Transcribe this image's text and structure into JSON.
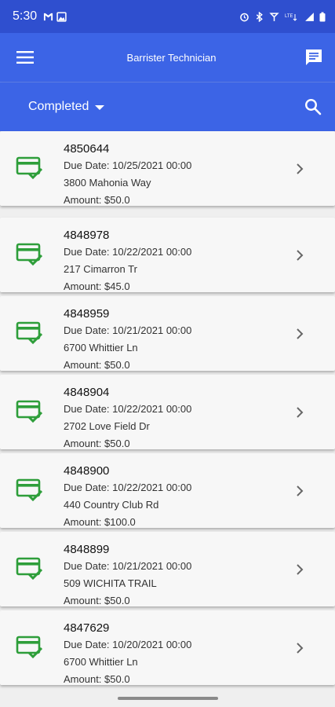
{
  "status_bar": {
    "time": "5:30",
    "left_icons": [
      "gmail-icon",
      "image-icon"
    ],
    "right_icons": [
      "alarm-icon",
      "bluetooth-icon",
      "hotspot-icon",
      "lte-icon",
      "signal-icon",
      "battery-icon"
    ],
    "network_label": "LTE"
  },
  "app_bar": {
    "title": "Barrister Technician",
    "menu_icon": "hamburger-menu-icon",
    "chat_icon": "chat-icon"
  },
  "filter_bar": {
    "selected": "Completed",
    "search_icon": "search-icon"
  },
  "work_orders": [
    {
      "number": "4850644",
      "due": "Due Date: 10/25/2021 00:00",
      "address": "3800 Mahonia Way",
      "amount": "Amount: $50.0"
    },
    {
      "number": "4848978",
      "due": "Due Date: 10/22/2021 00:00",
      "address": "217 Cimarron Tr",
      "amount": "Amount: $45.0"
    },
    {
      "number": "4848959",
      "due": "Due Date: 10/21/2021 00:00",
      "address": "6700 Whittier Ln",
      "amount": "Amount: $50.0"
    },
    {
      "number": "4848904",
      "due": "Due Date: 10/22/2021 00:00",
      "address": "2702 Love Field Dr",
      "amount": "Amount: $50.0"
    },
    {
      "number": "4848900",
      "due": "Due Date: 10/22/2021 00:00",
      "address": "440 Country Club Rd",
      "amount": "Amount: $100.0"
    },
    {
      "number": "4848899",
      "due": "Due Date: 10/21/2021 00:00",
      "address": "509 WICHITA TRAIL",
      "amount": "Amount: $50.0"
    },
    {
      "number": "4847629",
      "due": "Due Date: 10/20/2021 00:00",
      "address": "6700 Whittier Ln",
      "amount": "Amount: $50.0"
    }
  ],
  "colors": {
    "status_bar": "#2f4fcf",
    "app_bar": "#3c64e6",
    "icon_green": "#2e9e3a",
    "background": "#efefef"
  }
}
